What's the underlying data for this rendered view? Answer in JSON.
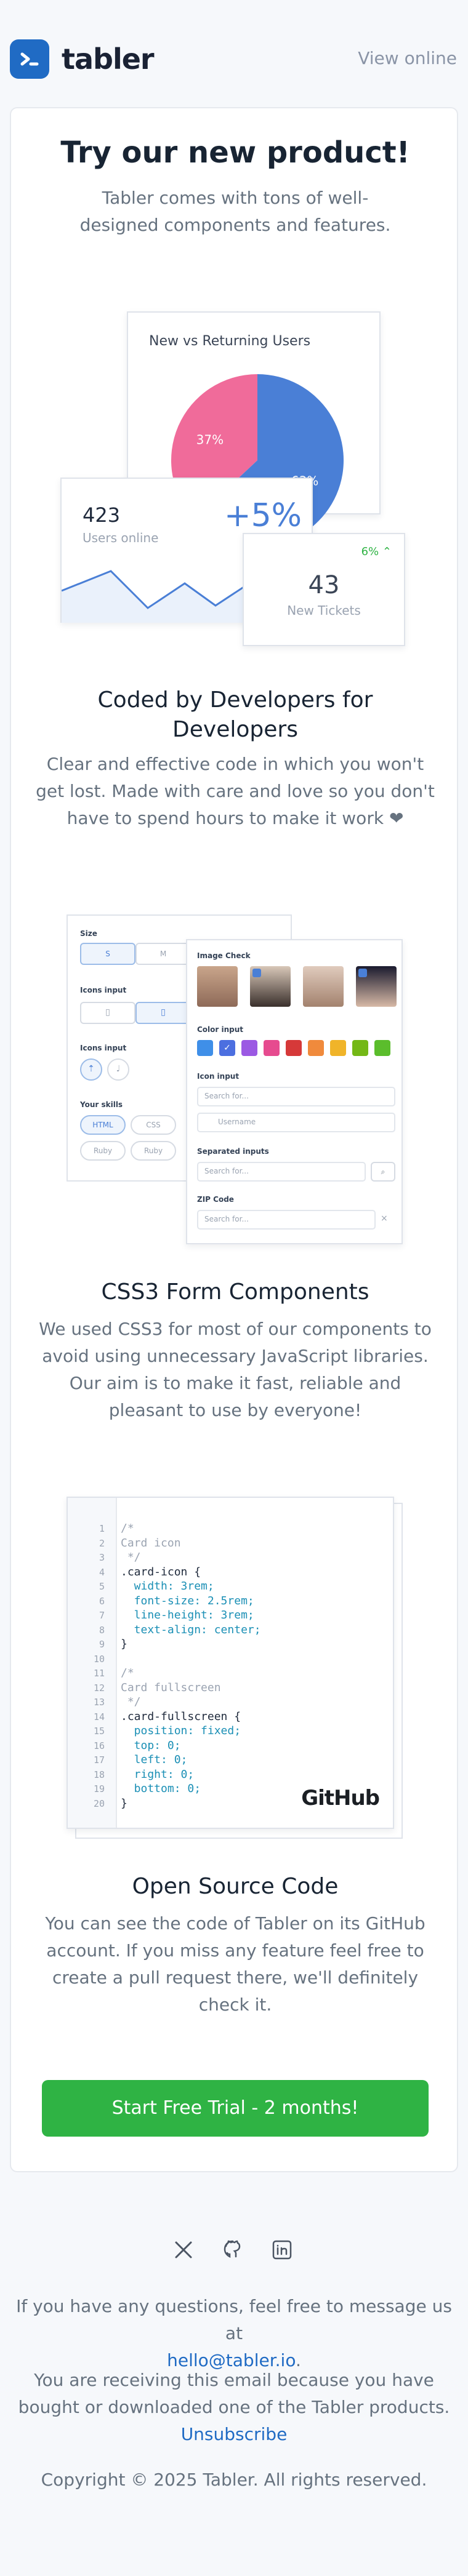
{
  "header": {
    "brand": "tabler",
    "view_online": "View online"
  },
  "hero": {
    "title": "Try our new product!",
    "subtitle": "Tabler comes with tons of well-designed components and features."
  },
  "dashboard_illustration": {
    "chart_title": "New vs Returning Users",
    "chart_data": {
      "type": "pie",
      "values": [
        37,
        63
      ],
      "labels": [
        "37%",
        "63%"
      ],
      "colors": [
        "#f06b9a",
        "#4a7fd6"
      ]
    },
    "users_online_value": "423",
    "users_online_label": "Users online",
    "users_online_change": "+5%",
    "tickets_change": "6%",
    "tickets_value": "43",
    "tickets_label": "New Tickets"
  },
  "section1": {
    "title": "Coded by Developers for Developers",
    "text": "Clear and effective code in which you won't get lost. Made with care and love so you don't have to spend hours to make it work ❤"
  },
  "form_illustration": {
    "size_label": "Size",
    "size_s": "S",
    "size_m": "M",
    "icons_input_label": "Icons input",
    "icons_input_label2": "Icons input",
    "your_skills_label": "Your skills",
    "skills": [
      "HTML",
      "CSS",
      "Ruby",
      "Ruby"
    ],
    "image_check_label": "Image Check",
    "color_input_label": "Color input",
    "colors": [
      "#3f8fe8",
      "#4c6fe0",
      "#9b59e3",
      "#e64b8f",
      "#d63939",
      "#f08a3c",
      "#f0b429",
      "#74b816",
      "#5bbd2c"
    ],
    "icon_input_label": "Icon input",
    "search_placeholder": "Search for...",
    "username_placeholder": "Username",
    "separated_inputs_label": "Separated inputs",
    "search_placeholder2": "Search for...",
    "zip_code_label": "ZIP Code",
    "search_placeholder3": "Search for..."
  },
  "section2": {
    "title": "CSS3 Form Components",
    "text": "We used CSS3 for most of our components to avoid using unnecessary JavaScript libraries. Our aim is to make it fast, reliable and pleasant to use by everyone!"
  },
  "code_illustration": {
    "lines": [
      {
        "n": "1",
        "t": "/*"
      },
      {
        "n": "2",
        "t": "Card icon"
      },
      {
        "n": "3",
        "t": " */"
      },
      {
        "n": "4",
        "t": ".card-icon {"
      },
      {
        "n": "5",
        "t": "  width: 3rem;"
      },
      {
        "n": "6",
        "t": "  font-size: 2.5rem;"
      },
      {
        "n": "7",
        "t": "  line-height: 3rem;"
      },
      {
        "n": "8",
        "t": "  text-align: center;"
      },
      {
        "n": "9",
        "t": "}"
      },
      {
        "n": "10",
        "t": ""
      },
      {
        "n": "11",
        "t": "/*"
      },
      {
        "n": "12",
        "t": "Card fullscreen"
      },
      {
        "n": "13",
        "t": " */"
      },
      {
        "n": "14",
        "t": ".card-fullscreen {"
      },
      {
        "n": "15",
        "t": "  position: fixed;"
      },
      {
        "n": "16",
        "t": "  top: 0;"
      },
      {
        "n": "17",
        "t": "  left: 0;"
      },
      {
        "n": "18",
        "t": "  right: 0;"
      },
      {
        "n": "19",
        "t": "  bottom: 0;"
      },
      {
        "n": "20",
        "t": "}"
      }
    ],
    "github_label": "GitHub"
  },
  "section3": {
    "title": "Open Source Code",
    "text": "You can see the code of Tabler on its GitHub account. If you miss any feature feel free to create a pull request there, we'll definitely check it."
  },
  "cta": {
    "label": "Start Free Trial - 2 months!"
  },
  "footer": {
    "social_icons": [
      "x-icon",
      "github-icon",
      "linkedin-icon"
    ],
    "questions_text": "If you have any questions, feel free to message us at",
    "email": "hello@tabler.io",
    "email_suffix": ".",
    "receiving_text": "You are receiving this email because you have bought or downloaded one of the Tabler products.",
    "unsubscribe": "Unsubscribe",
    "copyright": "Copyright © 2025 Tabler. All rights reserved."
  }
}
